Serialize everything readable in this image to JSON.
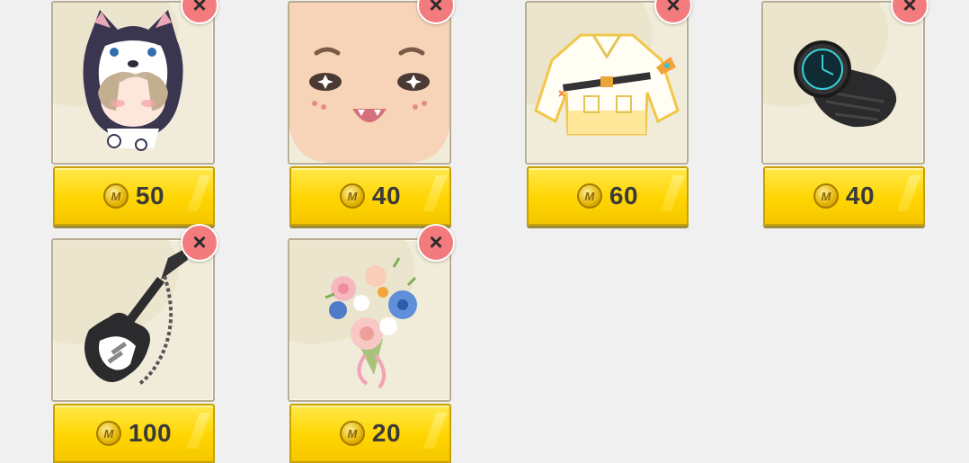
{
  "items": [
    {
      "name": "husky-hood-costume",
      "price": "50",
      "icon": "husky-hood-icon"
    },
    {
      "name": "smiling-face",
      "price": "40",
      "icon": "smiling-face-icon"
    },
    {
      "name": "white-jacket",
      "price": "60",
      "icon": "jacket-icon"
    },
    {
      "name": "black-watch",
      "price": "40",
      "icon": "watch-icon"
    },
    {
      "name": "electric-guitar",
      "price": "100",
      "icon": "guitar-icon"
    },
    {
      "name": "flower-bouquet",
      "price": "20",
      "icon": "bouquet-icon"
    }
  ],
  "coin_symbol": "M",
  "remove_symbol": "×",
  "colors": {
    "price_bg": "#ffd500",
    "remove_bg": "#f47b7d",
    "tile_bg": "#f1ecd9"
  }
}
